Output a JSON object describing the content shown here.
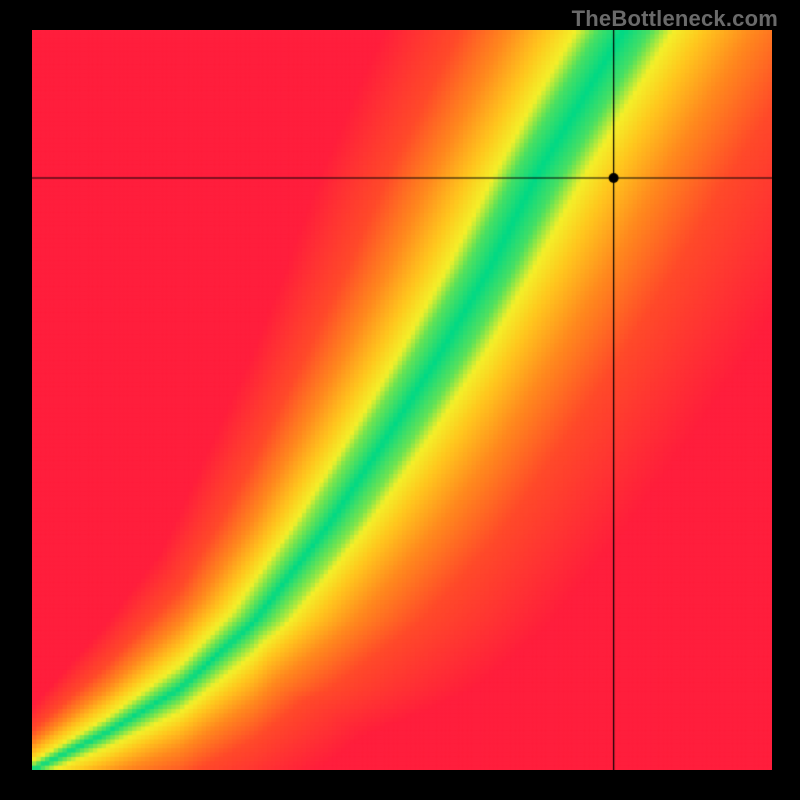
{
  "watermark": "TheBottleneck.com",
  "chart_data": {
    "type": "heatmap",
    "title": "",
    "xlabel": "",
    "ylabel": "",
    "xlim": [
      0,
      1
    ],
    "ylim": [
      0,
      1
    ],
    "crosshair": {
      "x": 0.786,
      "y": 0.8
    },
    "marker": {
      "x": 0.786,
      "y": 0.8
    },
    "color_stops": [
      {
        "d": 0.0,
        "color": "#00D986"
      },
      {
        "d": 0.06,
        "color": "#6FE452"
      },
      {
        "d": 0.12,
        "color": "#F4F02A"
      },
      {
        "d": 0.22,
        "color": "#FFC81E"
      },
      {
        "d": 0.38,
        "color": "#FF8A1E"
      },
      {
        "d": 0.6,
        "color": "#FF4A2A"
      },
      {
        "d": 1.0,
        "color": "#FF1E3C"
      }
    ],
    "ridge_samples": [
      {
        "x": 0.0,
        "y": 0.0,
        "half_width": 0.005
      },
      {
        "x": 0.1,
        "y": 0.05,
        "half_width": 0.01
      },
      {
        "x": 0.2,
        "y": 0.11,
        "half_width": 0.016
      },
      {
        "x": 0.3,
        "y": 0.2,
        "half_width": 0.022
      },
      {
        "x": 0.4,
        "y": 0.33,
        "half_width": 0.03
      },
      {
        "x": 0.48,
        "y": 0.45,
        "half_width": 0.036
      },
      {
        "x": 0.55,
        "y": 0.56,
        "half_width": 0.042
      },
      {
        "x": 0.62,
        "y": 0.68,
        "half_width": 0.048
      },
      {
        "x": 0.68,
        "y": 0.8,
        "half_width": 0.052
      },
      {
        "x": 0.74,
        "y": 0.9,
        "half_width": 0.054
      },
      {
        "x": 0.8,
        "y": 1.0,
        "half_width": 0.056
      }
    ],
    "grid": {
      "nx": 170,
      "ny": 170
    }
  }
}
